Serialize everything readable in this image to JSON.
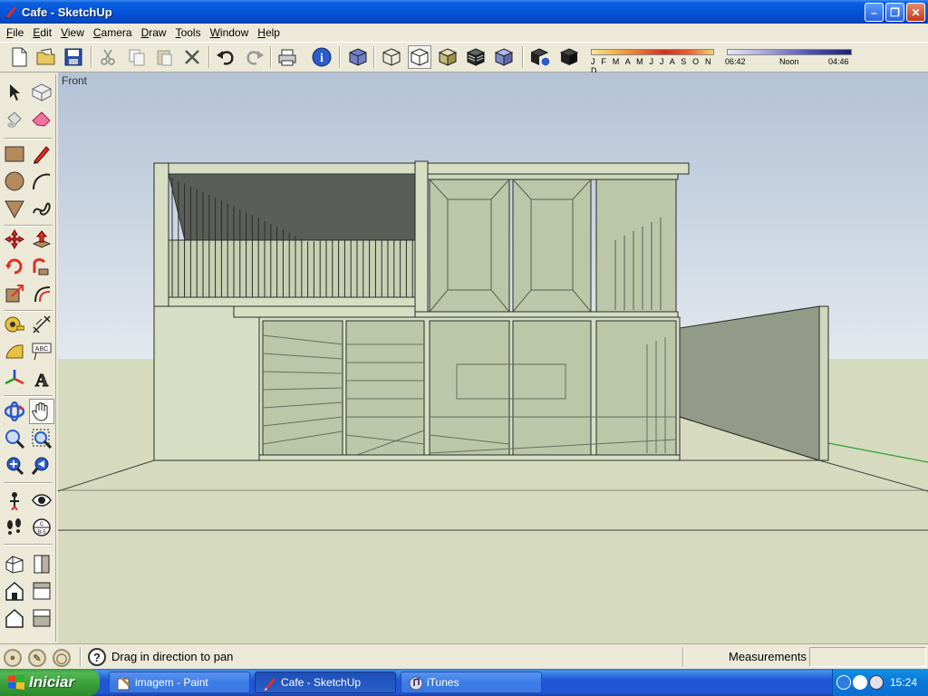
{
  "window": {
    "title": "Cafe - SketchUp"
  },
  "menu": [
    {
      "pre": "",
      "ul": "F",
      "post": "ile"
    },
    {
      "pre": "",
      "ul": "E",
      "post": "dit"
    },
    {
      "pre": "",
      "ul": "V",
      "post": "iew"
    },
    {
      "pre": "",
      "ul": "C",
      "post": "amera"
    },
    {
      "pre": "",
      "ul": "D",
      "post": "raw"
    },
    {
      "pre": "",
      "ul": "T",
      "post": "ools"
    },
    {
      "pre": "",
      "ul": "W",
      "post": "indow"
    },
    {
      "pre": "",
      "ul": "H",
      "post": "elp"
    }
  ],
  "shadows": {
    "months_label": "J F M A M J J A S O N D",
    "time_start": "06:42",
    "time_mid": "Noon",
    "time_end": "04:46"
  },
  "viewport": {
    "scene_label": "Front"
  },
  "status": {
    "hint": "Drag in direction to pan",
    "measurements_label": "Measurements",
    "measurements_value": ""
  },
  "taskbar": {
    "start_label": "Iniciar",
    "tasks": [
      {
        "label": "imagem - Paint"
      },
      {
        "label": "Cafe - SketchUp"
      },
      {
        "label": "iTunes"
      }
    ],
    "clock": "15:24"
  },
  "colors": {
    "model_face": "#d6dfc4",
    "model_glass": "#bcc6a8",
    "model_dark": "#5a5e58",
    "ground": "#d7dcc0",
    "axis_green": "#2ea02e"
  }
}
